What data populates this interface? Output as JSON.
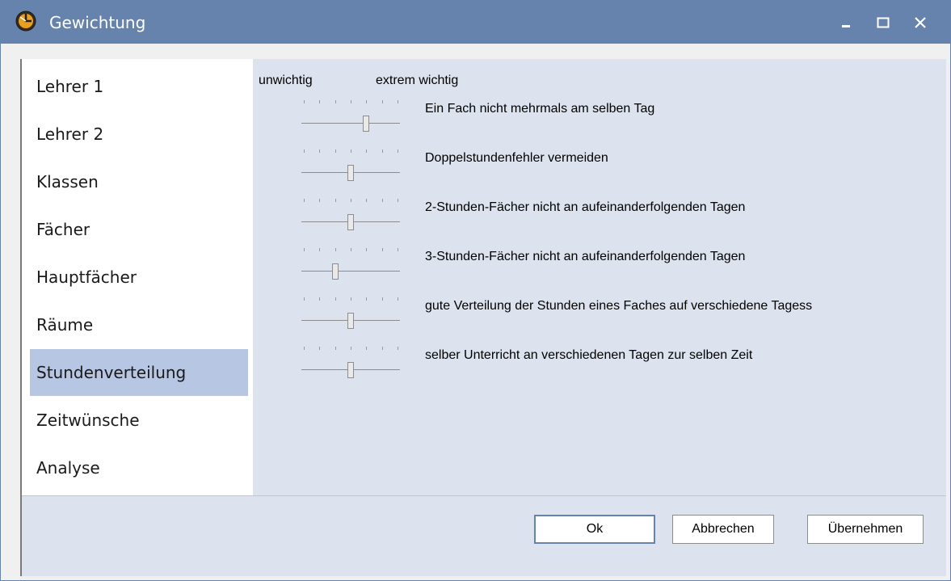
{
  "window": {
    "title": "Gewichtung",
    "icon": "clock-app-icon",
    "controls": [
      "minimize",
      "maximize",
      "close"
    ],
    "titlebar_color": "#6583ad"
  },
  "sidebar": {
    "items": [
      {
        "label": "Lehrer 1"
      },
      {
        "label": "Lehrer 2"
      },
      {
        "label": "Klassen"
      },
      {
        "label": "Fächer"
      },
      {
        "label": "Hauptfächer"
      },
      {
        "label": "Räume"
      },
      {
        "label": "Stundenverteilung",
        "selected": true
      },
      {
        "label": "Zeitwünsche"
      },
      {
        "label": "Analyse"
      }
    ],
    "selected_color": "#b7c6e2"
  },
  "weights": {
    "scale_min_label": "unwichtig",
    "scale_max_label": "extrem wichtig",
    "scale_steps": 7,
    "criteria": [
      {
        "label": "Ein Fach nicht mehrmals am selben Tag",
        "level": 4
      },
      {
        "label": "Doppelstundenfehler vermeiden",
        "level": 3
      },
      {
        "label": "2-Stunden-Fächer nicht an aufeinanderfolgenden Tagen",
        "level": 3
      },
      {
        "label": "3-Stunden-Fächer nicht an aufeinanderfolgenden Tagen",
        "level": 2
      },
      {
        "label": "gute Verteilung der Stunden eines Faches auf verschiedene Tagess",
        "level": 3
      },
      {
        "label": "selber Unterricht an verschiedenen Tagen zur selben Zeit",
        "level": 3
      }
    ]
  },
  "buttons": {
    "ok": "Ok",
    "cancel": "Abbrechen",
    "apply": "Übernehmen"
  }
}
